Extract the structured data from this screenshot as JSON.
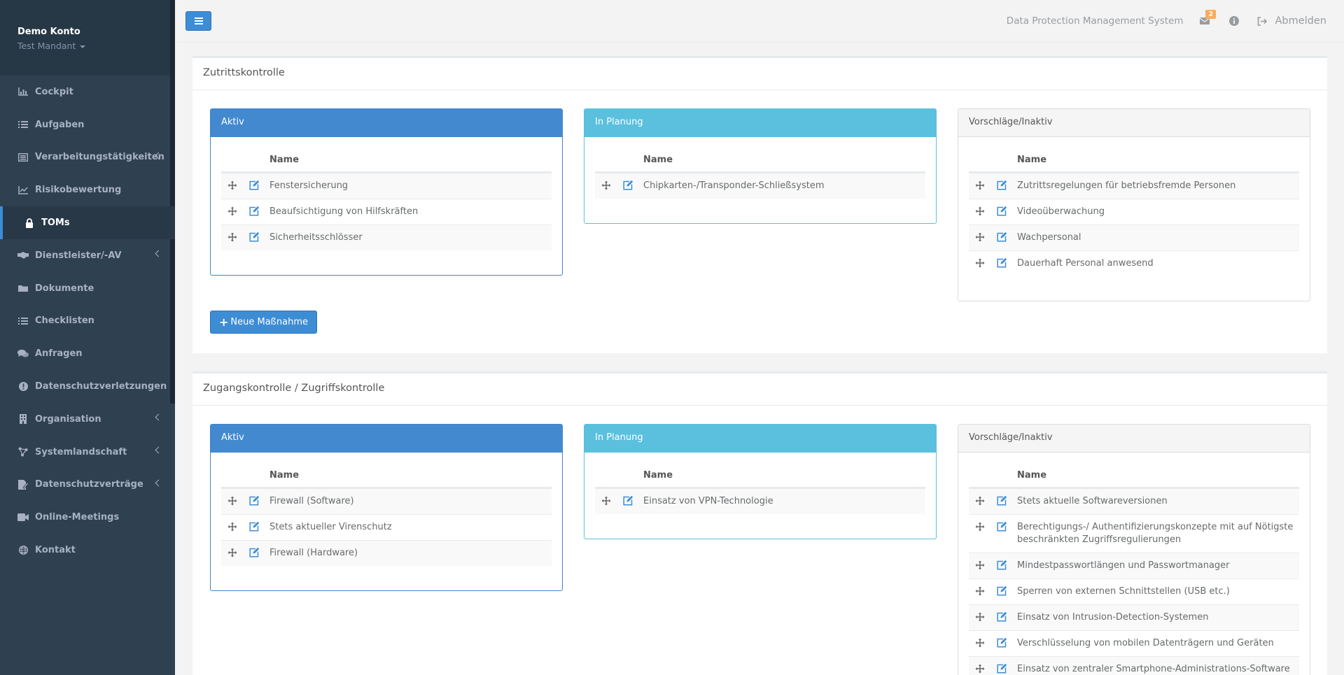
{
  "profile": {
    "account": "Demo Konto",
    "mandant": "Test Mandant"
  },
  "nav": [
    {
      "label": "Cockpit",
      "icon": "chart-icon",
      "arrow": false,
      "active": false
    },
    {
      "label": "Aufgaben",
      "icon": "list-icon",
      "arrow": false,
      "active": false
    },
    {
      "label": "Verarbeitungstätigkeiten",
      "icon": "list-alt-icon",
      "arrow": true,
      "active": false
    },
    {
      "label": "Risikobewertung",
      "icon": "line-chart-icon",
      "arrow": false,
      "active": false
    },
    {
      "label": "TOMs",
      "icon": "lock-icon",
      "arrow": false,
      "active": true
    },
    {
      "label": "Dienstleister/-AV",
      "icon": "handshake-icon",
      "arrow": true,
      "active": false
    },
    {
      "label": "Dokumente",
      "icon": "folder-icon",
      "arrow": false,
      "active": false
    },
    {
      "label": "Checklisten",
      "icon": "list-icon",
      "arrow": false,
      "active": false
    },
    {
      "label": "Anfragen",
      "icon": "comments-icon",
      "arrow": false,
      "active": false
    },
    {
      "label": "Datenschutzverletzungen",
      "icon": "exclamation-circle-icon",
      "arrow": false,
      "active": false
    },
    {
      "label": "Organisation",
      "icon": "building-icon",
      "arrow": true,
      "active": false
    },
    {
      "label": "Systemlandschaft",
      "icon": "network-icon",
      "arrow": true,
      "active": false
    },
    {
      "label": "Datenschutzverträge",
      "icon": "contract-icon",
      "arrow": true,
      "active": false
    },
    {
      "label": "Online-Meetings",
      "icon": "video-icon",
      "arrow": false,
      "active": false
    },
    {
      "label": "Kontakt",
      "icon": "globe-icon",
      "arrow": false,
      "active": false
    }
  ],
  "topbar": {
    "title": "Data Protection Management System",
    "mail_badge": "2",
    "logout": "Abmelden"
  },
  "sections": [
    {
      "title": "Zutrittskontrolle",
      "new_button": "Neue Maßnahme",
      "panels": [
        {
          "heading": "Aktiv",
          "column": "Name",
          "items": [
            "Fenstersicherung",
            "Beaufsichtigung von Hilfskräften",
            "Sicherheitsschlösser"
          ]
        },
        {
          "heading": "In Planung",
          "column": "Name",
          "items": [
            "Chipkarten-/Transponder-Schließsystem"
          ]
        },
        {
          "heading": "Vorschläge/Inaktiv",
          "column": "Name",
          "items": [
            "Zutrittsregelungen für betriebsfremde Personen",
            "Videoüberwachung",
            "Wachpersonal",
            "Dauerhaft Personal anwesend"
          ]
        }
      ]
    },
    {
      "title": "Zugangskontrolle / Zugriffskontrolle",
      "panels": [
        {
          "heading": "Aktiv",
          "column": "Name",
          "items": [
            "Firewall (Software)",
            "Stets aktueller Virenschutz",
            "Firewall (Hardware)"
          ]
        },
        {
          "heading": "In Planung",
          "column": "Name",
          "items": [
            "Einsatz von VPN-Technologie"
          ]
        },
        {
          "heading": "Vorschläge/Inaktiv",
          "column": "Name",
          "items": [
            "Stets aktuelle Softwareversionen",
            "Berechtigungs-/ Authentifizierungskonzepte mit auf Nötigste beschränkten Zugriffsregulierungen",
            "Mindestpasswortlängen und Passwortmanager",
            "Sperren von externen Schnittstellen (USB etc.)",
            "Einsatz von Intrusion-Detection-Systemen",
            "Verschlüsselung von mobilen Datenträgern und Geräten",
            "Einsatz von zentraler Smartphone-Administrations-Software"
          ]
        }
      ]
    }
  ]
}
